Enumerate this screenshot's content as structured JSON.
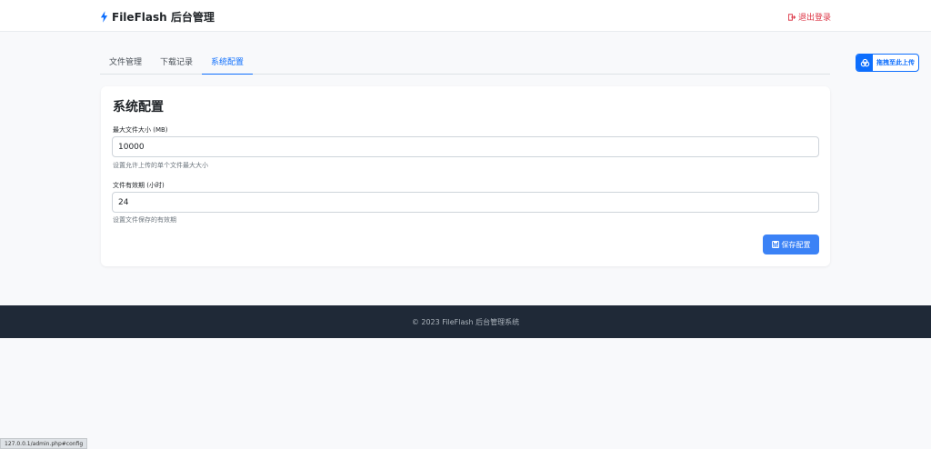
{
  "header": {
    "brand_title": "FileFlash 后台管理",
    "logout_label": "退出登录"
  },
  "tabs": [
    {
      "label": "文件管理",
      "active": false
    },
    {
      "label": "下载记录",
      "active": false
    },
    {
      "label": "系统配置",
      "active": true
    }
  ],
  "upload_button": {
    "label": "拖拽至此上传"
  },
  "config": {
    "title": "系统配置",
    "fields": [
      {
        "label": "最大文件大小 (MB)",
        "value": "10000",
        "help": "设置允许上传的单个文件最大大小"
      },
      {
        "label": "文件有效期 (小时)",
        "value": "24",
        "help": "设置文件保存的有效期"
      }
    ],
    "save_label": "保存配置"
  },
  "footer": {
    "text": "© 2023 FileFlash 后台管理系统"
  },
  "status_bar": {
    "url": "127.0.0.1/admin.php#config"
  },
  "colors": {
    "accent": "#0d6efd",
    "danger": "#dc3545",
    "footer_bg": "#1f2937",
    "save_button": "#3b82f6"
  }
}
